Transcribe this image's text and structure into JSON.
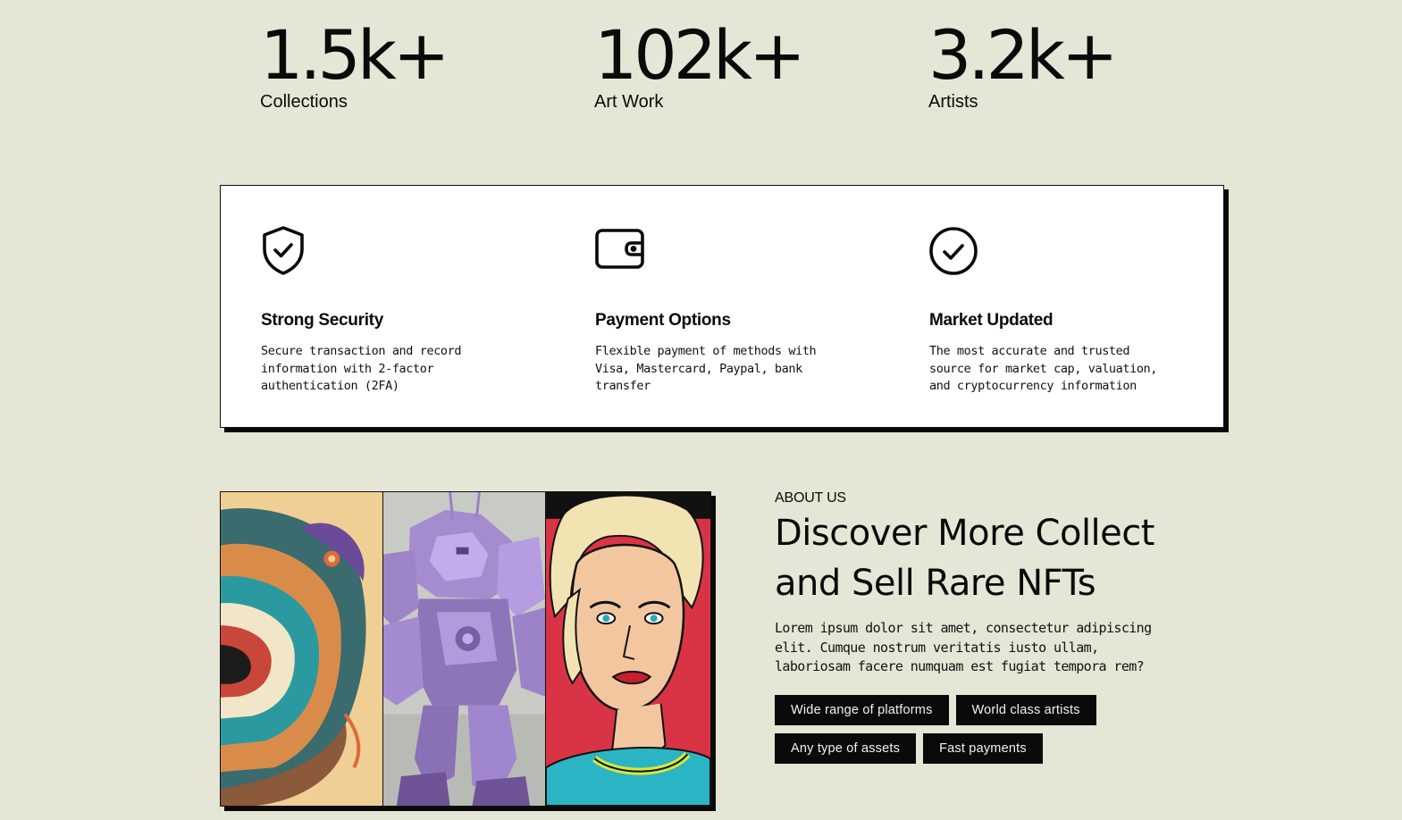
{
  "stats": [
    {
      "value": "1.5k+",
      "label": "Collections"
    },
    {
      "value": "102k+",
      "label": "Art Work"
    },
    {
      "value": "3.2k+",
      "label": "Artists"
    }
  ],
  "features": [
    {
      "icon": "shield-check-icon",
      "title": "Strong Security",
      "description": "Secure transaction and record information with 2-factor authentication (2FA)"
    },
    {
      "icon": "wallet-icon",
      "title": "Payment Options",
      "description": "Flexible payment of methods with Visa, Mastercard, Paypal, bank transfer"
    },
    {
      "icon": "check-circle-icon",
      "title": "Market Updated",
      "description": "The most accurate and trusted source for market cap, valuation, and cryptocurrency information"
    }
  ],
  "gallery": {
    "images": [
      "abstract-swirl-art",
      "purple-robot-art",
      "pop-art-woman"
    ]
  },
  "about": {
    "eyebrow": "ABOUT US",
    "title": "Discover More Collect and Sell Rare NFTs",
    "body": "Lorem ipsum dolor sit amet, consectetur adipiscing elit. Cumque nostrum veritatis iusto ullam, laboriosam facere numquam est fugiat tempora rem?",
    "tags": [
      "Wide range of platforms",
      "World class artists",
      "Any type of assets",
      "Fast payments"
    ]
  },
  "colors": {
    "background": "#e6e6d6",
    "ink": "#0a0a0a",
    "card": "#ffffff",
    "tag_text": "#f2f2f2"
  }
}
